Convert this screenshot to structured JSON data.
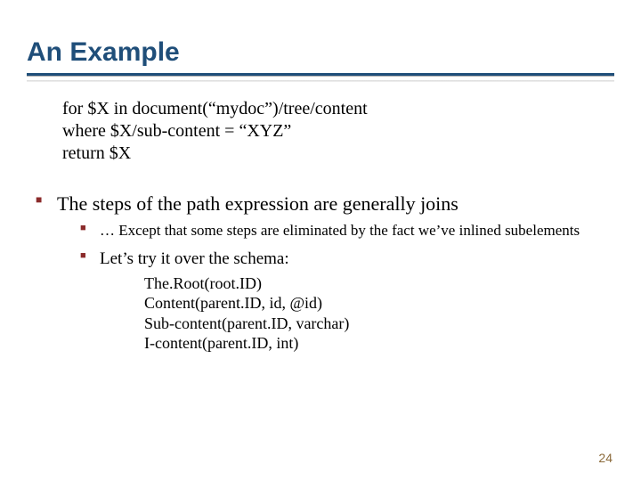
{
  "title": "An Example",
  "code": {
    "line1": "for $X in document(“mydoc”)/tree/content",
    "line2": "where $X/sub-content = “XYZ”",
    "line3": "return $X"
  },
  "bullet1": "The steps of the path expression are generally joins",
  "sub1": "… Except that some steps are eliminated by the fact we’ve inlined subelements",
  "sub2": "Let’s try it over the schema:",
  "schema": {
    "line1": "The.Root(root.ID)",
    "line2": "Content(parent.ID, id, @id)",
    "line3": "Sub-content(parent.ID, varchar)",
    "line4": "I-content(parent.ID, int)"
  },
  "page_number": "24"
}
